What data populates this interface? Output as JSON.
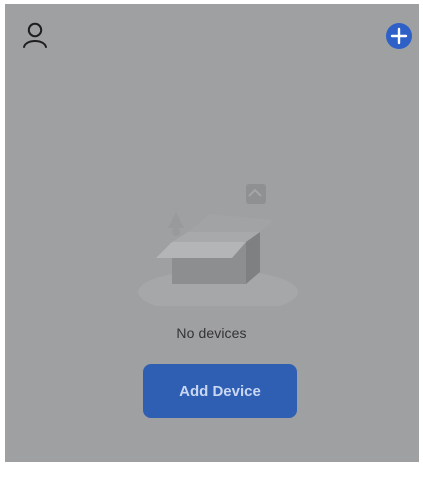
{
  "header": {
    "profile_icon": "person-outline-icon",
    "add_icon": "plus-circle-icon"
  },
  "empty_state": {
    "illustration": "empty-box-icon",
    "message": "No devices",
    "add_button_label": "Add Device"
  },
  "colors": {
    "overlay_background": "#9fa0a2",
    "accent_blue": "#2f5fb3",
    "add_icon_blue": "#2e60c8"
  }
}
